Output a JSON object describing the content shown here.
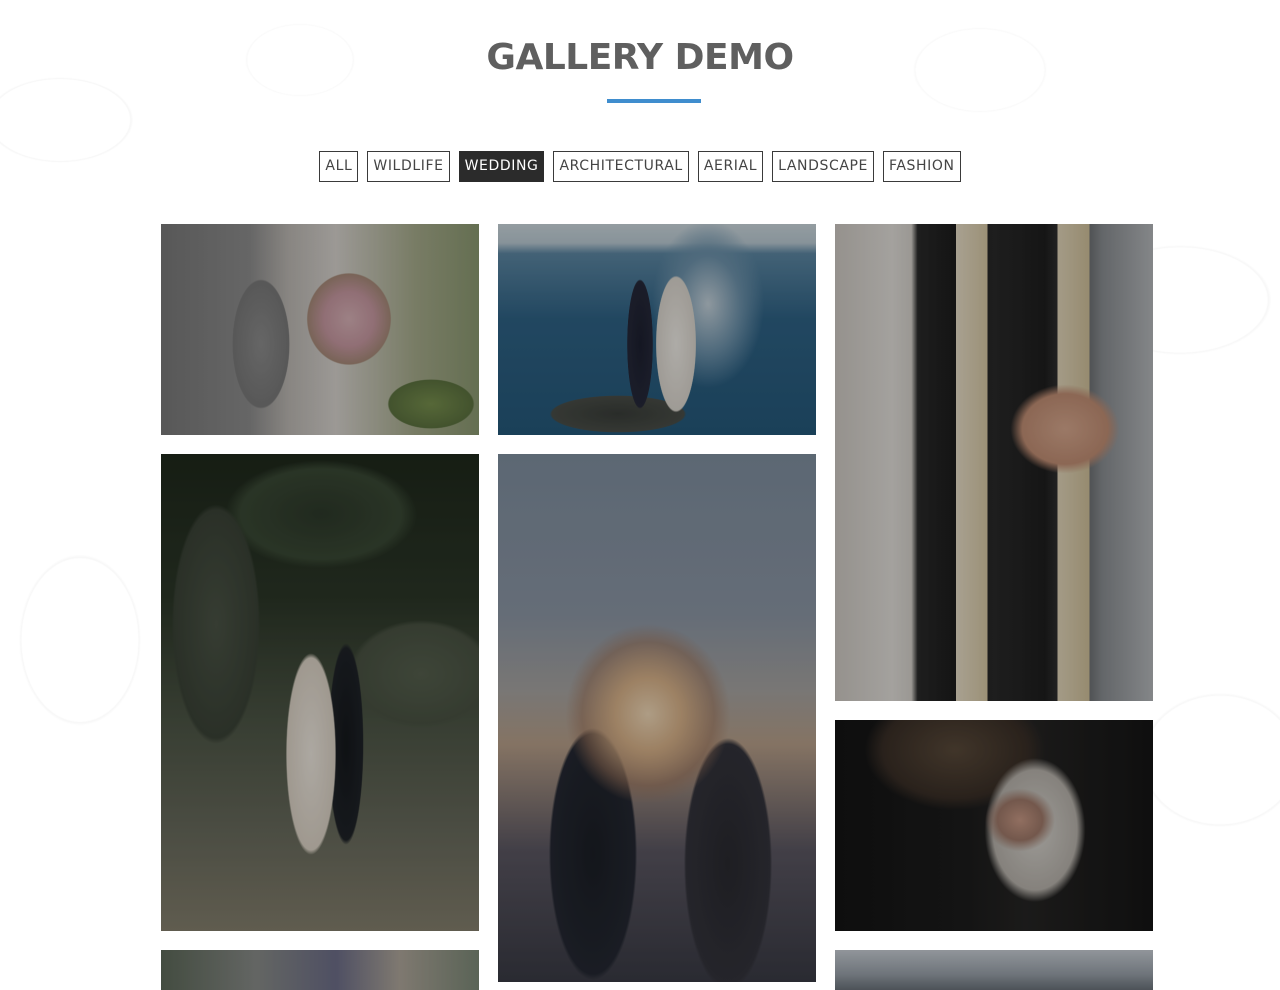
{
  "page": {
    "title": "GALLERY DEMO",
    "accent_color": "#3f8dce"
  },
  "filters": {
    "active": "WEDDING",
    "items": [
      {
        "label": "ALL"
      },
      {
        "label": "WILDLIFE"
      },
      {
        "label": "WEDDING"
      },
      {
        "label": "ARCHITECTURAL"
      },
      {
        "label": "AERIAL"
      },
      {
        "label": "LANDSCAPE"
      },
      {
        "label": "FASHION"
      }
    ]
  }
}
